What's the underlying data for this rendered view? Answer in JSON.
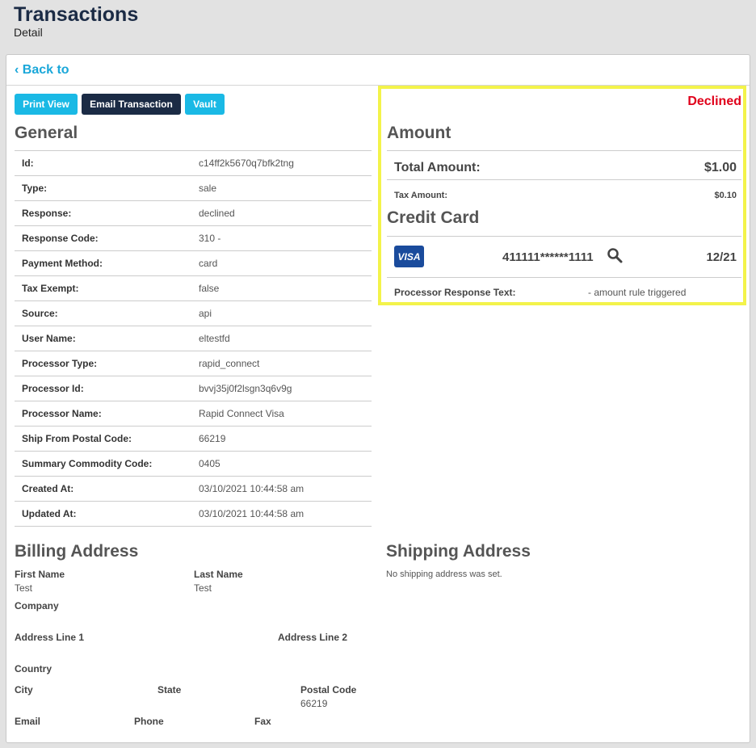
{
  "header": {
    "title": "Transactions",
    "subtitle": "Detail"
  },
  "back_label": "Back to",
  "buttons": {
    "print": "Print View",
    "email": "Email Transaction",
    "vault": "Vault"
  },
  "general": {
    "title": "General",
    "rows": [
      {
        "key": "Id:",
        "value": "c14ff2k5670q7bfk2tng"
      },
      {
        "key": "Type:",
        "value": "sale"
      },
      {
        "key": "Response:",
        "value": "declined"
      },
      {
        "key": "Response Code:",
        "value": "310 -"
      },
      {
        "key": "Payment Method:",
        "value": "card"
      },
      {
        "key": "Tax Exempt:",
        "value": "false"
      },
      {
        "key": "Source:",
        "value": "api"
      },
      {
        "key": "User Name:",
        "value": "eltestfd"
      },
      {
        "key": "Processor Type:",
        "value": "rapid_connect"
      },
      {
        "key": "Processor Id:",
        "value": "bvvj35j0f2lsgn3q6v9g"
      },
      {
        "key": "Processor Name:",
        "value": "Rapid Connect Visa"
      },
      {
        "key": "Ship From Postal Code:",
        "value": "66219"
      },
      {
        "key": "Summary Commodity Code:",
        "value": "0405"
      },
      {
        "key": "Created At:",
        "value": "03/10/2021 10:44:58 am"
      },
      {
        "key": "Updated At:",
        "value": "03/10/2021 10:44:58 am"
      }
    ]
  },
  "status": "Declined",
  "amount": {
    "title": "Amount",
    "total_label": "Total Amount:",
    "total_value": "$1.00",
    "tax_label": "Tax Amount:",
    "tax_value": "$0.10"
  },
  "credit_card": {
    "title": "Credit Card",
    "brand": "VISA",
    "number": "411111******1111",
    "expiry": "12/21",
    "processor_response_label": "Processor Response Text:",
    "processor_response_value": "- amount rule triggered"
  },
  "billing": {
    "title": "Billing Address",
    "first_name_label": "First Name",
    "first_name": "Test",
    "last_name_label": "Last Name",
    "last_name": "Test",
    "company_label": "Company",
    "address1_label": "Address Line 1",
    "address2_label": "Address Line 2",
    "country_label": "Country",
    "city_label": "City",
    "state_label": "State",
    "postal_code_label": "Postal Code",
    "postal_code": "66219",
    "email_label": "Email",
    "phone_label": "Phone",
    "fax_label": "Fax"
  },
  "shipping": {
    "title": "Shipping Address",
    "message": "No shipping address was set."
  },
  "colors": {
    "accent": "#1ab9e5",
    "navy": "#1b2b45",
    "declined": "#e0001a",
    "highlight": "#f3f34a",
    "visa": "#1a4b9c"
  },
  "icons": {
    "back": "chevron-left-icon",
    "search": "search-icon"
  }
}
